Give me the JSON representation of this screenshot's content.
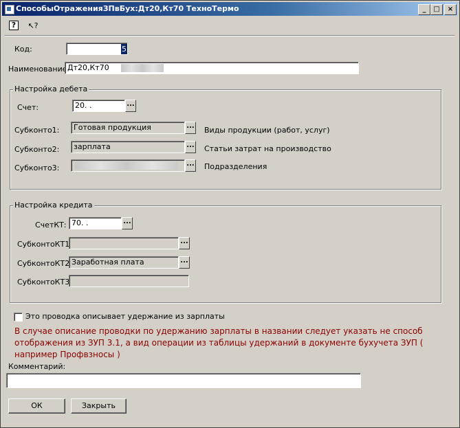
{
  "window": {
    "title": "СпособыОтраженияЗПвБух:Дт20,Кт70 ТехноТермо",
    "controls": [
      "_",
      "□",
      "×"
    ]
  },
  "toolbar": {
    "help_icon": "?",
    "whatis_icon": "↖?"
  },
  "form": {
    "code_label": "Код:",
    "code_value": "",
    "code_suffix": "5",
    "name_label": "Наименование:",
    "name_value": "Дт20,Кт70"
  },
  "debit": {
    "group_title": "Настройка дебета",
    "account_label": "Счет:",
    "account_value": "20. .",
    "rows": [
      {
        "label": "Субконто1:",
        "value": "Готовая продукция",
        "type": "Виды продукции (работ, услуг)"
      },
      {
        "label": "Субконто2:",
        "value": "зарплата",
        "type": "Статьи затрат на производство"
      },
      {
        "label": "Субконто3:",
        "value": "",
        "type": "Подразделения"
      }
    ]
  },
  "credit": {
    "group_title": "Настройка кредита",
    "account_label": "СчетКТ:",
    "account_value": "70. .",
    "rows": [
      {
        "label": "СубконтоКТ1:",
        "value": ""
      },
      {
        "label": "СубконтоКТ2:",
        "value": "Заработная плата"
      },
      {
        "label": "СубконтоКТ3:",
        "value": ""
      }
    ]
  },
  "deduction": {
    "checkbox_label": "Это проводка описывает удержание из зарплаты",
    "checked": false,
    "note": "В случае описание проводки по удержанию зарплаты  в названии следует указать не способ отображения из ЗУП 3.1, а вид операции из таблицы удержаний в документе бухучета ЗУП ( например Профвзносы )"
  },
  "comment": {
    "label": "Комментарий:",
    "value": ""
  },
  "buttons": {
    "ok": "ОК",
    "close": "Закрыть"
  },
  "dots_label": "..."
}
